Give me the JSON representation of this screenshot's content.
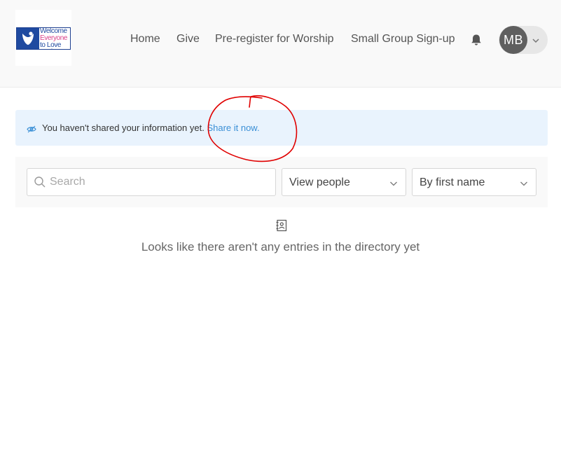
{
  "header": {
    "logo": {
      "alt": "Welcome Everyone to Love God",
      "lines": [
        "Welcome",
        "Everyone",
        "to Love God"
      ]
    },
    "nav": [
      {
        "label": "Home"
      },
      {
        "label": "Give"
      },
      {
        "label": "Pre-register for Worship"
      },
      {
        "label": "Small Group Sign-up"
      }
    ],
    "notifications_icon": "bell-icon",
    "user": {
      "initials": "MB",
      "menu_icon": "chevron-down-icon"
    }
  },
  "info_banner": {
    "icon": "eye-icon",
    "message": "You haven't shared your information yet.",
    "link_label": "Share it now.",
    "link_color": "#3a8fd6",
    "background": "#e9f3fd"
  },
  "filters": {
    "search": {
      "placeholder": "Search",
      "value": ""
    },
    "view": {
      "selected": "View people"
    },
    "sort": {
      "selected": "By first name"
    }
  },
  "empty_state": {
    "icon": "address-book-icon",
    "message": "Looks like there aren't any entries in the directory yet"
  },
  "annotation": {
    "color": "#e00000",
    "kind": "hand-drawn circle"
  }
}
